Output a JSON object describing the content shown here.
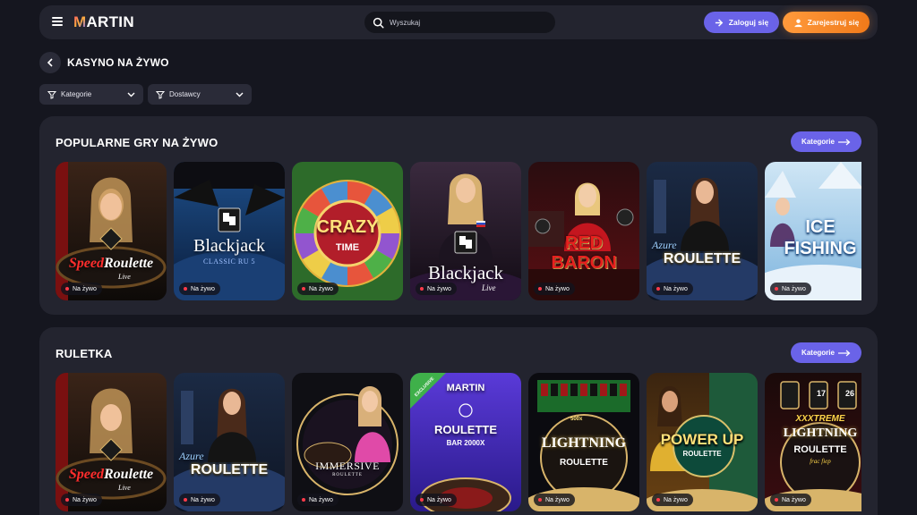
{
  "header": {
    "logo": "MARTIN",
    "search_placeholder": "Wyszukaj",
    "login_label": "Zaloguj się",
    "register_label": "Zarejestruj się"
  },
  "page": {
    "title": "KASYNO NA ŻYWO"
  },
  "filters": {
    "categories": "Kategorie",
    "providers": "Dostawcy"
  },
  "live_badge": "Na żywo",
  "sections": [
    {
      "title": "POPULARNE GRY NA ŻYWO",
      "button": "Kategorie",
      "games": [
        {
          "title_a": "Speed",
          "title_b": "Roulette",
          "sub": "Live"
        },
        {
          "title": "Blackjack",
          "sub": "CLASSIC RU 5"
        },
        {
          "title": "CRAZY",
          "sub": "TIME"
        },
        {
          "title": "Blackjack",
          "sub": "Live"
        },
        {
          "title": "RED",
          "sub": "BARON"
        },
        {
          "title_a": "Azure",
          "title_b": "ROULETTE"
        },
        {
          "title": "ICE",
          "sub": "FISHING"
        }
      ]
    },
    {
      "title": "RULETKA",
      "button": "Kategorie",
      "games": [
        {
          "title_a": "Speed",
          "title_b": "Roulette",
          "sub": "Live"
        },
        {
          "title_a": "Azure",
          "title_b": "ROULETTE"
        },
        {
          "title": "IMMERSIVE",
          "sub": "ROULETTE"
        },
        {
          "tag": "EXCLUSIVE",
          "brand": "MARTIN",
          "title": "ROULETTE",
          "sub": "BAR 2000X"
        },
        {
          "top": "500x",
          "title": "LIGHTNING",
          "sub": "ROULETTE"
        },
        {
          "title": "POWER UP",
          "sub": "ROULETTE"
        },
        {
          "nums": [
            "17",
            "26"
          ],
          "title_a": "XXXTREME",
          "title": "LIGHTNING",
          "title_b": "ROULETTE",
          "sub": "frac fiep"
        }
      ]
    }
  ],
  "colors": {
    "accent": "#6a63e8",
    "register": "#f07a1a",
    "live_dot": "#ff3b4a"
  }
}
